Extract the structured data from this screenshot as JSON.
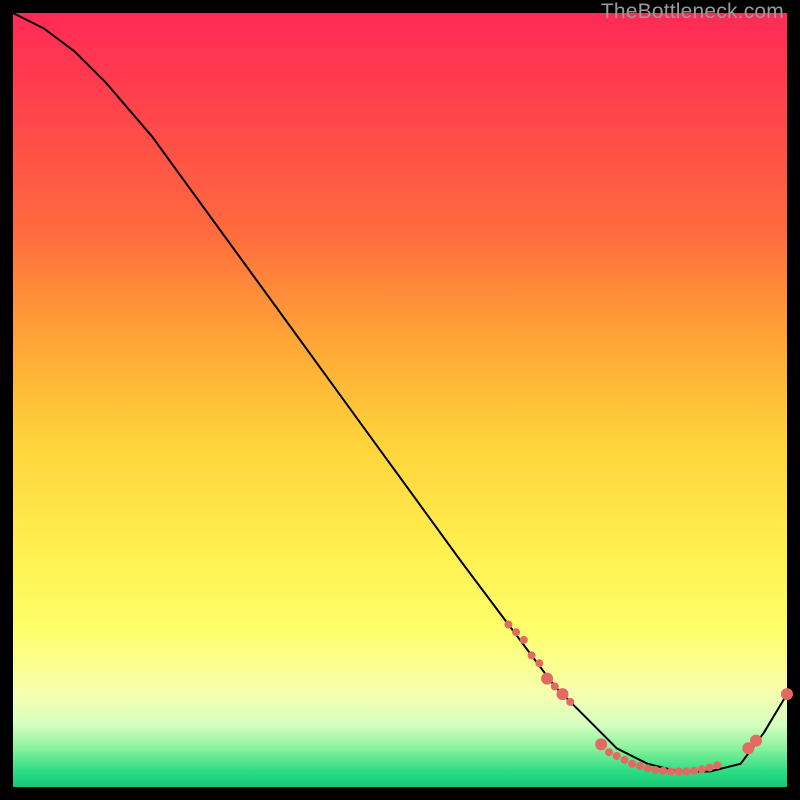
{
  "watermark": "TheBottleneck.com",
  "chart_data": {
    "type": "line",
    "title": "",
    "xlabel": "",
    "ylabel": "",
    "xlim": [
      0,
      100
    ],
    "ylim": [
      0,
      100
    ],
    "grid": false,
    "series": [
      {
        "name": "bottleneck-curve",
        "color": "#000000",
        "x": [
          0,
          4,
          8,
          12,
          18,
          26,
          34,
          42,
          50,
          58,
          64,
          70,
          74,
          78,
          82,
          86,
          90,
          94,
          97,
          100
        ],
        "y": [
          100,
          98,
          95,
          91,
          84,
          73,
          62,
          51,
          40,
          29,
          21,
          13,
          9,
          5,
          3,
          2,
          2,
          3,
          7,
          12
        ]
      }
    ],
    "markers": [
      {
        "name": "highlight-points",
        "color": "#e36a63",
        "radius_small": 4,
        "radius_large": 6,
        "points": [
          {
            "x": 64,
            "y": 21,
            "r": "small"
          },
          {
            "x": 65,
            "y": 20,
            "r": "small"
          },
          {
            "x": 66,
            "y": 19,
            "r": "small"
          },
          {
            "x": 67,
            "y": 17,
            "r": "small"
          },
          {
            "x": 68,
            "y": 16,
            "r": "small"
          },
          {
            "x": 69,
            "y": 14,
            "r": "large"
          },
          {
            "x": 70,
            "y": 13,
            "r": "small"
          },
          {
            "x": 71,
            "y": 12,
            "r": "large"
          },
          {
            "x": 72,
            "y": 11,
            "r": "small"
          },
          {
            "x": 76,
            "y": 5.5,
            "r": "large"
          },
          {
            "x": 77,
            "y": 4.5,
            "r": "small"
          },
          {
            "x": 78,
            "y": 4,
            "r": "small"
          },
          {
            "x": 79,
            "y": 3.5,
            "r": "small"
          },
          {
            "x": 80,
            "y": 3,
            "r": "small"
          },
          {
            "x": 81,
            "y": 2.7,
            "r": "small"
          },
          {
            "x": 82,
            "y": 2.4,
            "r": "small"
          },
          {
            "x": 83,
            "y": 2.2,
            "r": "small"
          },
          {
            "x": 84,
            "y": 2.1,
            "r": "small"
          },
          {
            "x": 85,
            "y": 2,
            "r": "small"
          },
          {
            "x": 86,
            "y": 2,
            "r": "small"
          },
          {
            "x": 87,
            "y": 2,
            "r": "small"
          },
          {
            "x": 88,
            "y": 2.1,
            "r": "small"
          },
          {
            "x": 89,
            "y": 2.3,
            "r": "small"
          },
          {
            "x": 90,
            "y": 2.5,
            "r": "small"
          },
          {
            "x": 91,
            "y": 2.8,
            "r": "small"
          },
          {
            "x": 95,
            "y": 5,
            "r": "large"
          },
          {
            "x": 96,
            "y": 6,
            "r": "large"
          },
          {
            "x": 100,
            "y": 12,
            "r": "large"
          }
        ]
      }
    ]
  }
}
